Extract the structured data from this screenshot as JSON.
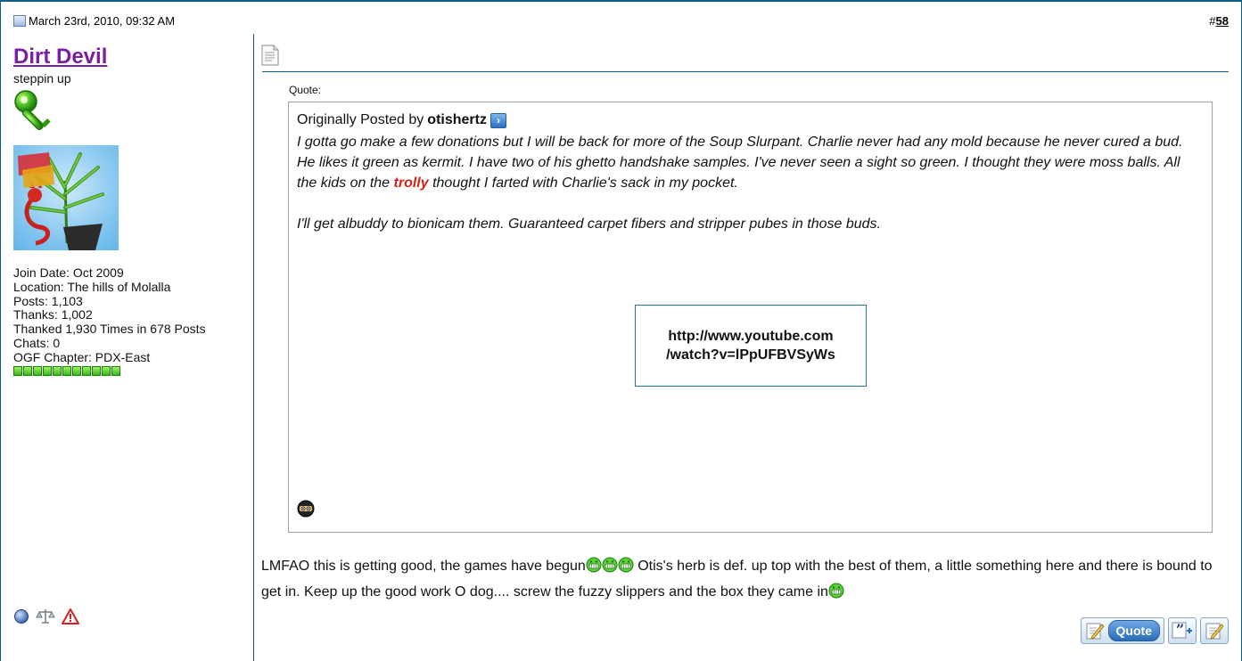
{
  "post": {
    "date": "March 23rd, 2010, 09:32 AM",
    "number_prefix": "#",
    "number": "58"
  },
  "user": {
    "name": "Dirt Devil",
    "title": "steppin up",
    "join_date": "Join Date: Oct 2009",
    "location": "Location: The hills of Molalla",
    "posts": "Posts: 1,103",
    "thanks": "Thanks: 1,002",
    "thanked": "Thanked 1,930 Times in 678 Posts",
    "chats": "Chats: 0",
    "chapter": "OGF Chapter: PDX-East",
    "reputation_segments": 11
  },
  "quote": {
    "label": "Quote:",
    "originally_posted_by": "Originally Posted by",
    "author": "otishertz",
    "text_before_trolly": "I gotta go make a few donations but I will be back for more of the Soup Slurpant. Charlie never had any mold because he never cured a bud. He likes it green as kermit. I have two of his ghetto handshake samples. I've never seen a sight so green. I thought they were moss balls. All the kids on the ",
    "trolly": "trolly",
    "text_after_trolly": " thought I farted with Charlie's sack in my pocket.",
    "second_paragraph": "I'll get albuddy to bionicam them. Guaranteed carpet fibers and stripper pubes in those buds.",
    "video_line1": "http://www.youtube.com",
    "video_line2": "/watch?v=lPpUFBVSyWs"
  },
  "reply": {
    "part1": "LMFAO this is getting good, the games have begun",
    "part2": " Otis's herb is def. up top with the best of them, a little something here and there is bound to get in. Keep up the good work O dog.... screw the fuzzy slippers and the box they came in"
  },
  "buttons": {
    "quote_label": "Quote"
  },
  "colors": {
    "border": "#0b5e84",
    "username": "#7a1fa2",
    "trolly": "#d6201a",
    "video_border": "#1f7c94"
  }
}
